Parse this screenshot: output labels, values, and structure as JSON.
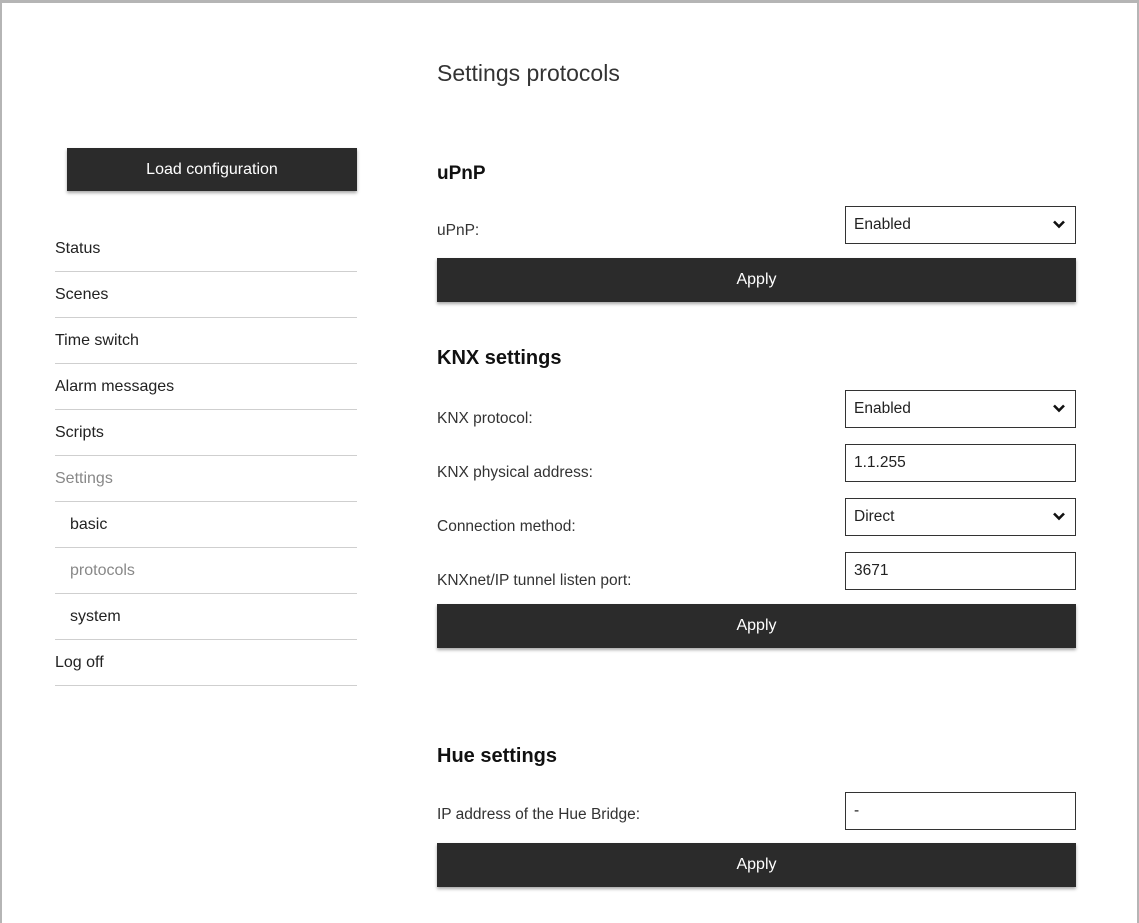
{
  "page_title": "Settings protocols",
  "sidebar": {
    "load_button": "Load configuration",
    "items": [
      {
        "label": "Status"
      },
      {
        "label": "Scenes"
      },
      {
        "label": "Time switch"
      },
      {
        "label": "Alarm messages"
      },
      {
        "label": "Scripts"
      },
      {
        "label": "Settings"
      },
      {
        "label": "basic"
      },
      {
        "label": "protocols"
      },
      {
        "label": "system"
      },
      {
        "label": "Log off"
      }
    ]
  },
  "upnp": {
    "title": "uPnP",
    "label": "uPnP:",
    "value": "Enabled",
    "apply": "Apply"
  },
  "knx": {
    "title": "KNX settings",
    "protocol_label": "KNX protocol:",
    "protocol_value": "Enabled",
    "address_label": "KNX physical address:",
    "address_value": "1.1.255",
    "method_label": "Connection method:",
    "method_value": "Direct",
    "port_label": "KNXnet/IP tunnel listen port:",
    "port_value": "3671",
    "apply": "Apply"
  },
  "hue": {
    "title": "Hue settings",
    "ip_label": "IP address of the Hue Bridge:",
    "ip_value": "-",
    "apply": "Apply"
  },
  "icons": {
    "dropdown": "chevron-down-icon"
  },
  "colors": {
    "button_bg": "#2b2b2b",
    "muted_text": "#888888",
    "divider": "#cfcfcf"
  }
}
